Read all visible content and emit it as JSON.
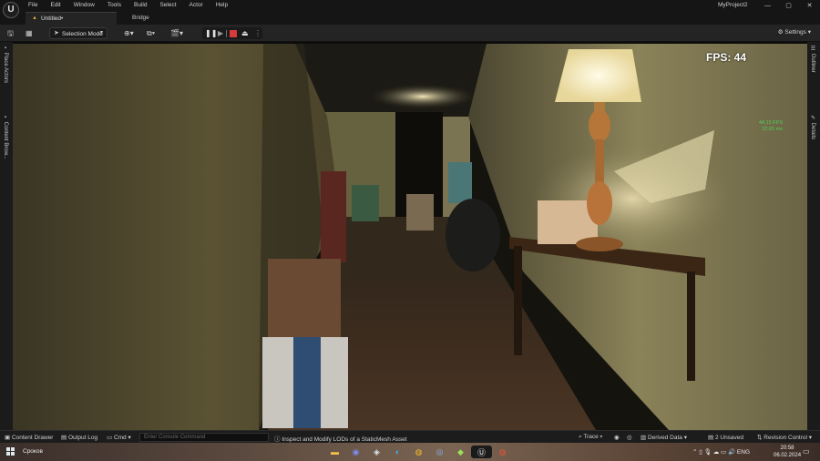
{
  "app": {
    "logo_text": "U",
    "project_name": "MyProject2",
    "menu": [
      "File",
      "Edit",
      "Window",
      "Tools",
      "Build",
      "Select",
      "Actor",
      "Help"
    ],
    "window_controls": [
      "—",
      "▢",
      "✕"
    ]
  },
  "tabs": [
    {
      "label": "Untitled•",
      "active": true
    },
    {
      "label": "Bridge",
      "active": false
    }
  ],
  "toolbar": {
    "selection_mode": "Selection Mode",
    "settings_label": "Settings",
    "icons": [
      "save-icon",
      "content-icon",
      "add-actor-icon",
      "blueprint-icon",
      "cinematics-icon",
      "pause-icon",
      "step-icon",
      "stop-icon",
      "eject-icon",
      "more-icon",
      "settings-icon"
    ]
  },
  "side_panels": {
    "left": [
      "Place Actors",
      "Content Brow..."
    ],
    "right": [
      "Outliner",
      "Details"
    ]
  },
  "viewport": {
    "fps_text": "FPS: 44",
    "stat_fps": "44.15 FPS",
    "stat_ms": "22.65 ms"
  },
  "statusbar": {
    "content_drawer": "Content Drawer",
    "output_log": "Output Log",
    "cmd": "Cmd",
    "console_placeholder": "Enter Console Command",
    "hint": "Inspect and Modify LODs of a StaticMesh Asset",
    "trace": "Trace",
    "derived_data": "Derived Data",
    "unsaved": "2 Unsaved",
    "revision_control": "Revision Control"
  },
  "taskbar": {
    "search_label": "Сроков",
    "language": "ENG",
    "time": "20:58",
    "date": "06.02.2024"
  },
  "colors": {
    "accent_green": "#4fd05a",
    "stop_red": "#d83a3a",
    "level_icon": "#d2a23d"
  }
}
